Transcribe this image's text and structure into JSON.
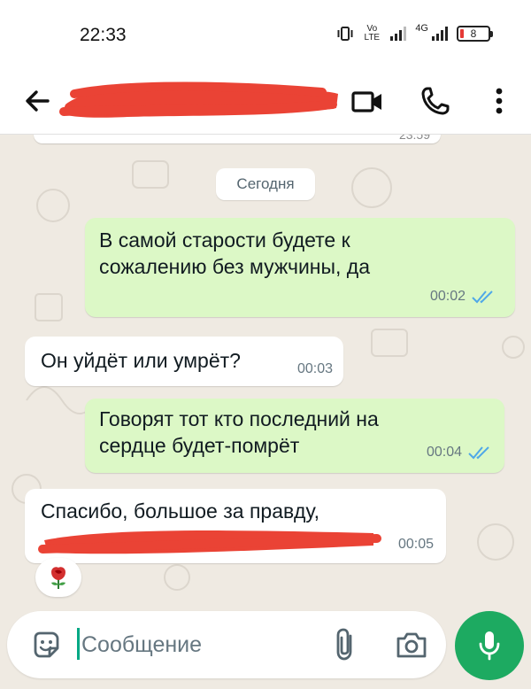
{
  "status_bar": {
    "time": "22:33",
    "network_label": "4G",
    "volte_label": "Vo LTE",
    "battery_level": "8"
  },
  "header": {
    "contact_name_redacted": true,
    "icons": [
      "back-arrow-icon",
      "video-call-icon",
      "phone-icon",
      "more-vert-icon"
    ]
  },
  "chat": {
    "date_separator": "Сегодня",
    "previous_message_time_partial": "23:59",
    "messages": [
      {
        "direction": "outgoing",
        "text_lines": [
          "В самой старости будете к",
          "сожалению без мужчины, да"
        ],
        "time": "00:02",
        "status": "read"
      },
      {
        "direction": "incoming",
        "text_lines": [
          "Он уйдёт или умрёт?"
        ],
        "time": "00:03"
      },
      {
        "direction": "outgoing",
        "text_lines": [
          "Говорят тот кто последний на",
          "сердце будет-помрёт"
        ],
        "time": "00:04",
        "status": "read"
      },
      {
        "direction": "incoming",
        "text_lines": [
          "Спасибо, большое за правду,"
        ],
        "redacted_second_line": true,
        "time": "00:05",
        "reaction": "🌹"
      }
    ]
  },
  "composer": {
    "placeholder": "Сообщение",
    "icons": [
      "emoji-icon",
      "attach-icon",
      "camera-icon",
      "mic-icon"
    ]
  },
  "colors": {
    "outgoing_bubble": "#dcf8c6",
    "incoming_bubble": "#ffffff",
    "chat_background": "#efeae2",
    "accent_green": "#1daa61",
    "read_tick": "#4fa8e8",
    "redaction_red": "#ea4335"
  }
}
